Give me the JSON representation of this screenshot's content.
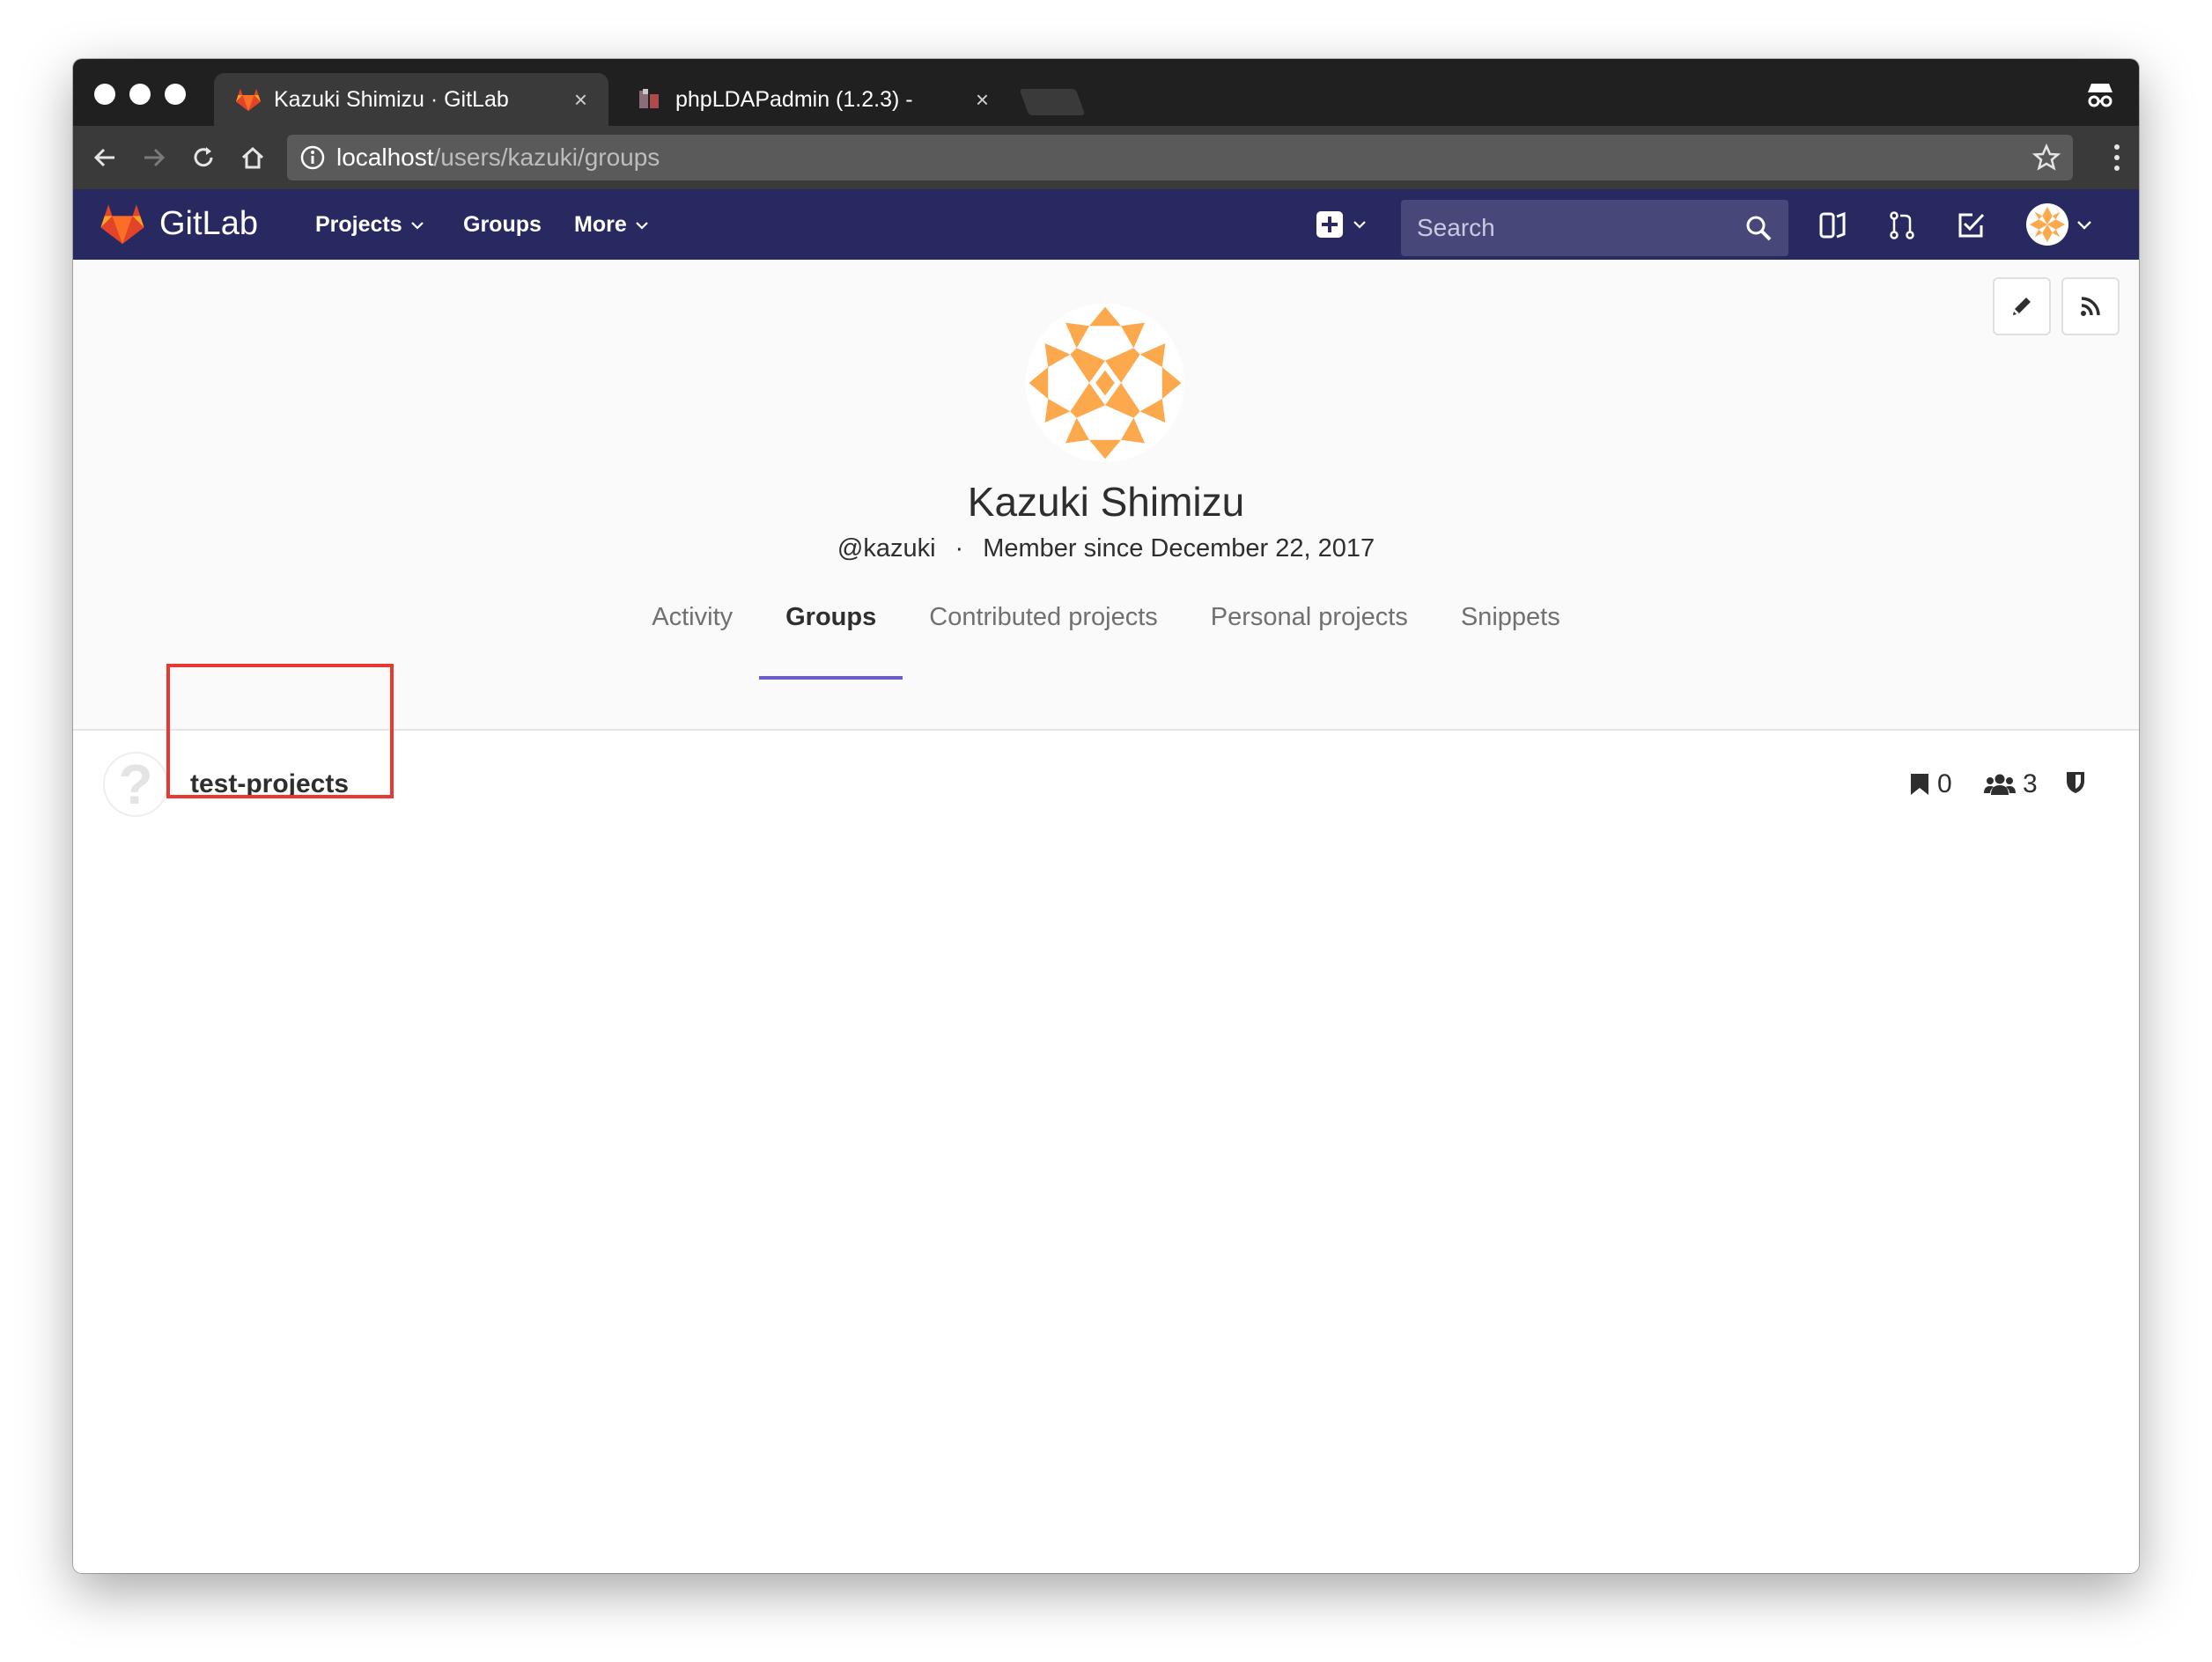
{
  "browser": {
    "tabs": [
      {
        "title": "Kazuki Shimizu · GitLab",
        "active": true,
        "close": "×"
      },
      {
        "title": "phpLDAPadmin (1.2.3) -",
        "active": false,
        "close": "×"
      }
    ],
    "url_host": "localhost",
    "url_path": "/users/kazuki/groups"
  },
  "gitlab_header": {
    "brand": "GitLab",
    "nav": [
      "Projects",
      "Groups",
      "More"
    ],
    "search_placeholder": "Search"
  },
  "profile": {
    "name": "Kazuki Shimizu",
    "username": "@kazuki",
    "separator": "·",
    "member_since": "Member since December 22, 2017",
    "tabs": [
      {
        "label": "Activity",
        "active": false
      },
      {
        "label": "Groups",
        "active": true
      },
      {
        "label": "Contributed projects",
        "active": false
      },
      {
        "label": "Personal projects",
        "active": false
      },
      {
        "label": "Snippets",
        "active": false
      }
    ]
  },
  "groups": [
    {
      "avatar_glyph": "?",
      "name": "test-projects",
      "projects": "0",
      "members": "3"
    }
  ],
  "colors": {
    "header_bg": "#292961",
    "active_tab_underline": "#6b5fc7",
    "highlight": "#e8382f",
    "avatar_orange": "#fca94d"
  }
}
